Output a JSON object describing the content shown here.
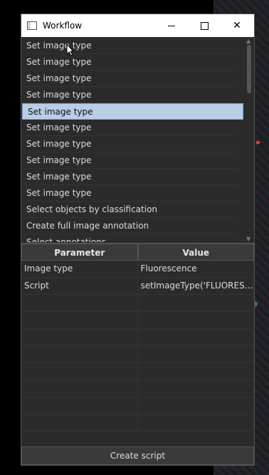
{
  "window": {
    "title": "Workflow"
  },
  "list_items": [
    "Set image type",
    "Set image type",
    "Set image type",
    "Set image type",
    "Set image type",
    "Set image type",
    "Set image type",
    "Set image type",
    "Set image type",
    "Set image type",
    "Select objects by classification",
    "Create full image annotation",
    "Select annotations..."
  ],
  "selected_index": 4,
  "table": {
    "headers": [
      "Parameter",
      "Value"
    ],
    "rows": [
      [
        "Image type",
        "Fluorescence"
      ],
      [
        "Script",
        "setImageType('FLUORESCENCE');"
      ]
    ]
  },
  "footer": {
    "create_script_label": "Create script"
  }
}
